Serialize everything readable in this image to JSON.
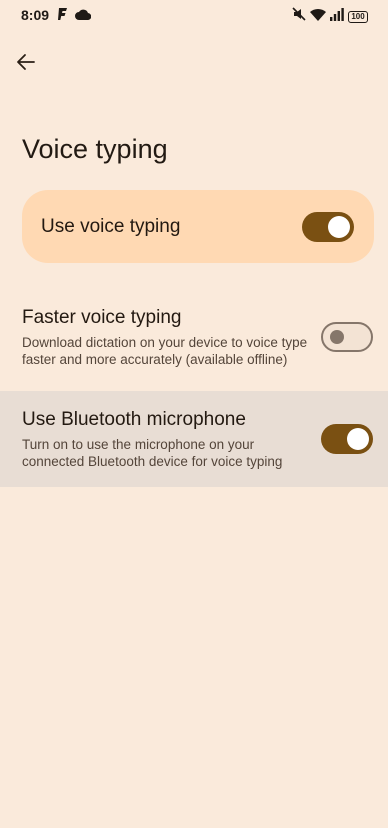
{
  "status_bar": {
    "time": "8:09",
    "battery": "100",
    "left_icons": [
      "f-app-icon",
      "cloud-icon"
    ],
    "right_icons": [
      "mute-icon",
      "wifi-icon",
      "signal-icon",
      "battery-icon"
    ]
  },
  "app_bar": {
    "back_icon": "arrow-back-icon"
  },
  "page": {
    "title": "Voice typing"
  },
  "main_toggle": {
    "label": "Use voice typing",
    "on": true
  },
  "settings": [
    {
      "title": "Faster voice typing",
      "summary": "Download dictation on your device to voice type faster and more accurately (available offline)",
      "on": false
    },
    {
      "title": "Use Bluetooth microphone",
      "summary": "Turn on to use the microphone on your connected Bluetooth device for voice typing",
      "on": true
    }
  ],
  "colors": {
    "background": "#faeadb",
    "card": "#ffd9b3",
    "accent": "#7a5012",
    "highlight_row": "#e8ddd4"
  }
}
